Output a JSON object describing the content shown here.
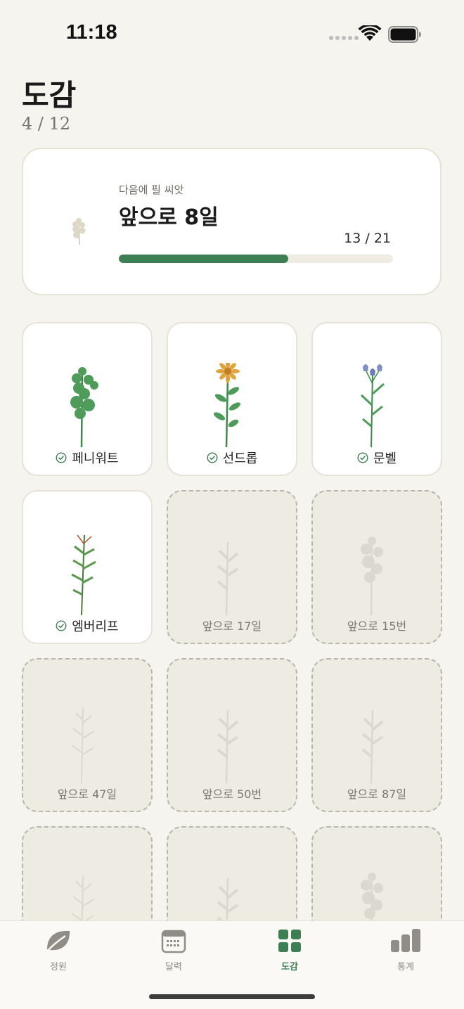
{
  "status_bar": {
    "time": "11:18"
  },
  "header": {
    "title": "도감",
    "progress": "4 / 12"
  },
  "next_seed": {
    "label": "다음에 필 씨앗",
    "value": "앞으로 8일",
    "ratio": "13 / 21",
    "progress_fraction": 0.619,
    "icon": "eucalyptus-sprig-icon"
  },
  "collection": [
    {
      "label": "페니워트",
      "unlocked": true,
      "plant": "pennywort",
      "icon": "check-circle-icon"
    },
    {
      "label": "선드롭",
      "unlocked": true,
      "plant": "sundrop",
      "icon": "check-circle-icon"
    },
    {
      "label": "문벨",
      "unlocked": true,
      "plant": "moonbell",
      "icon": "check-circle-icon"
    },
    {
      "label": "엠버리프",
      "unlocked": true,
      "plant": "emberleaf",
      "icon": "check-circle-icon"
    },
    {
      "label": "앞으로 17일",
      "unlocked": false,
      "plant": "sprig"
    },
    {
      "label": "앞으로 15번",
      "unlocked": false,
      "plant": "round"
    },
    {
      "label": "앞으로 47일",
      "unlocked": false,
      "plant": "fern"
    },
    {
      "label": "앞으로 50번",
      "unlocked": false,
      "plant": "sprig"
    },
    {
      "label": "앞으로 87일",
      "unlocked": false,
      "plant": "sprig"
    },
    {
      "label": "",
      "unlocked": false,
      "plant": "fern"
    },
    {
      "label": "",
      "unlocked": false,
      "plant": "sprig"
    },
    {
      "label": "",
      "unlocked": false,
      "plant": "round"
    }
  ],
  "tab_bar": {
    "tabs": [
      {
        "label": "정원",
        "icon": "leaf-icon",
        "active": false
      },
      {
        "label": "달력",
        "icon": "calendar-icon",
        "active": false
      },
      {
        "label": "도감",
        "icon": "grid-icon",
        "active": true
      },
      {
        "label": "통계",
        "icon": "bar-chart-icon",
        "active": false
      }
    ]
  },
  "colors": {
    "accent": "#3e7e53",
    "background": "#f6f4ee",
    "card": "#ffffff",
    "locked_tile": "#eeece2"
  }
}
